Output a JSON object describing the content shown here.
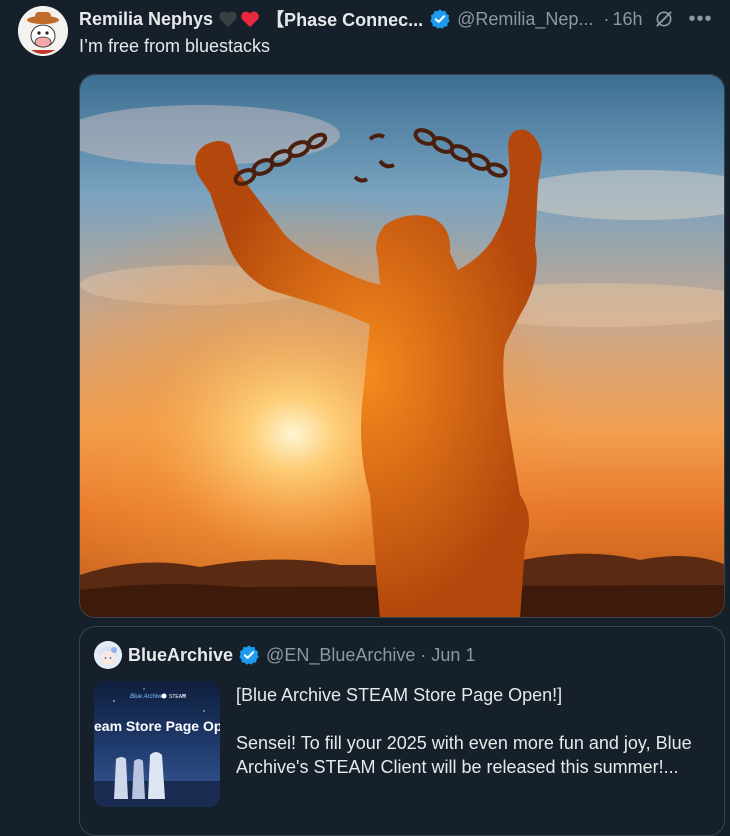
{
  "tweet": {
    "author_name": "Remilia Nephys",
    "affiliation": "【Phase Connec...",
    "handle": "@Remilia_Nep...",
    "separator": "·",
    "time": "16h",
    "text": "I’m free from bluestacks",
    "icons": [
      "avatar",
      "black-heart-icon",
      "red-heart-icon",
      "verified-badge-icon",
      "grok-icon",
      "more-icon"
    ],
    "more_label": "•••"
  },
  "quote": {
    "author_name": "BlueArchive",
    "handle": "@EN_BlueArchive",
    "separator": "·",
    "date": "Jun 1",
    "line1": "[Blue Archive STEAM Store Page Open!]",
    "line2": "Sensei! To fill your 2025 with even more fun and joy, Blue Archive's STEAM Client will be released this summer!...",
    "thumb": {
      "logo_text": "Blue Archive",
      "steam_text": "STEAM",
      "banner_text": "eam Store Page Op"
    }
  },
  "colors": {
    "background": "#15202b",
    "text": "#e7e9ea",
    "muted": "#8b98a5",
    "verified": "#1d9bf0",
    "border": "#38444d",
    "heart_red": "#f91880"
  }
}
